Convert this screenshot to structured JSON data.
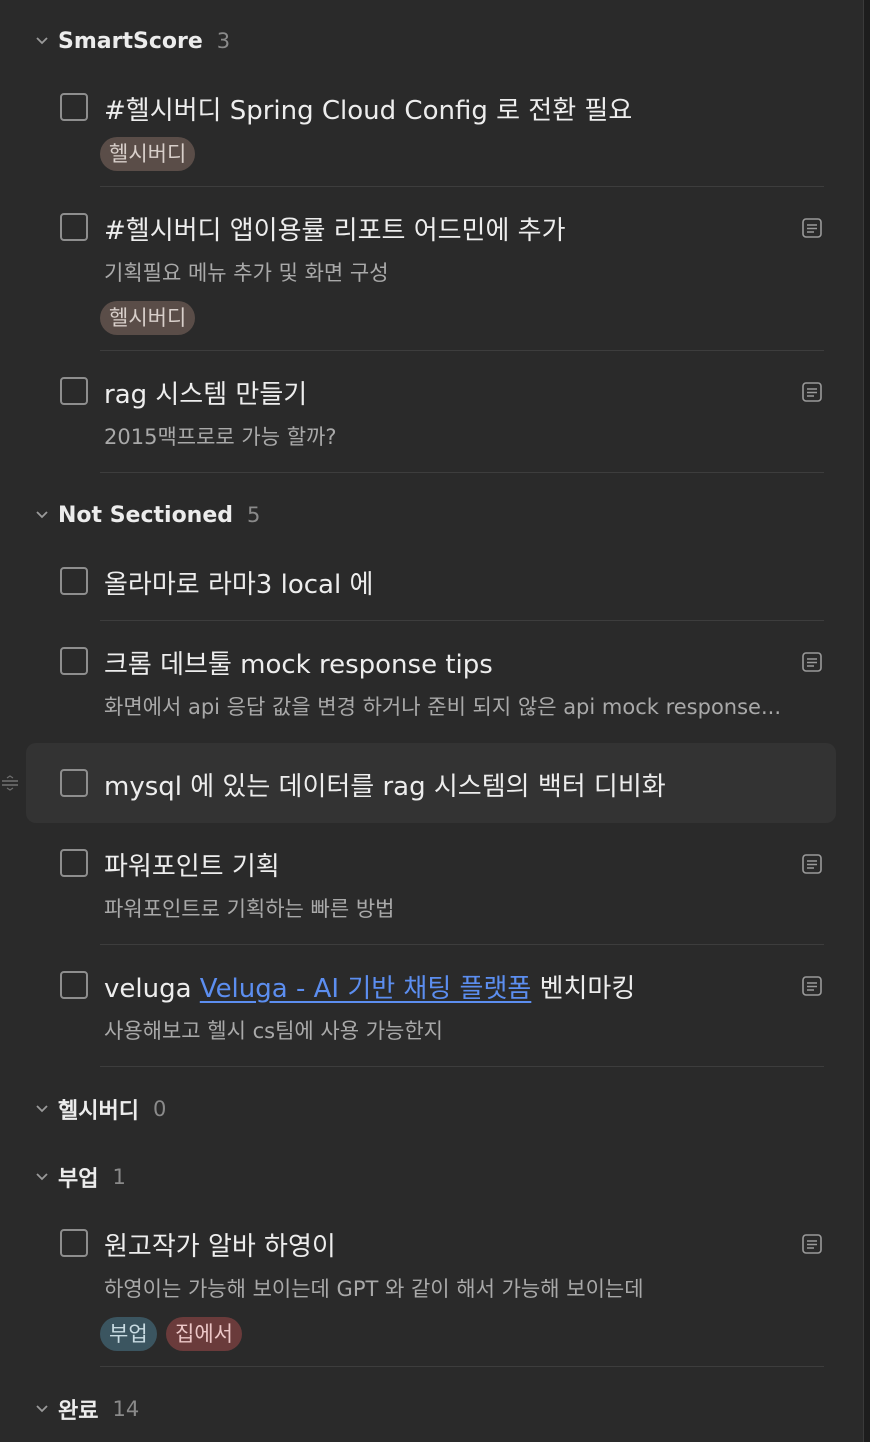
{
  "colors": {
    "background": "#2a2a2a",
    "tag_healthbuddy": "#5a4d48",
    "tag_sidejob": "#3b5560",
    "tag_home": "#6a3b3b",
    "link": "#5c8ef0"
  },
  "sections": [
    {
      "title": "SmartScore",
      "count": "3",
      "tasks": [
        {
          "title": "#헬시버디 Spring Cloud Config 로 전환 필요",
          "tags": [
            "헬시버디"
          ]
        },
        {
          "title": "#헬시버디 앱이용률 리포트 어드민에 추가",
          "desc": "기획필요 메뉴 추가 및 화면 구성",
          "tags": [
            "헬시버디"
          ],
          "icon": "note-icon"
        },
        {
          "title": "rag 시스템 만들기",
          "desc": "2015맥프로로 가능 할까?",
          "icon": "note-icon"
        }
      ]
    },
    {
      "title": "Not Sectioned",
      "count": "5",
      "tasks": [
        {
          "title": "올라마로 라마3 local 에"
        },
        {
          "title": "크롬 데브툴 mock response tips",
          "desc": "화면에서 api 응답 값을 변경 하거나 준비 되지 않은 api mock response...",
          "icon": "note-icon"
        },
        {
          "title": "mysql 에 있는 데이터를 rag 시스템의 백터 디비화"
        },
        {
          "title": "파워포인트 기획",
          "desc": "파워포인트로 기획하는 빠른 방법",
          "icon": "note-icon"
        },
        {
          "title_prefix": "veluga ",
          "title_link": "Veluga - AI 기반 채팅 플랫폼",
          "title_suffix": " 벤치마킹",
          "desc": "사용해보고 헬시 cs팀에 사용 가능한지",
          "icon": "note-icon"
        }
      ]
    },
    {
      "title": "헬시버디",
      "count": "0",
      "tasks": []
    },
    {
      "title": "부업",
      "count": "1",
      "tasks": [
        {
          "title": "원고작가 알바 하영이",
          "desc": "하영이는 가능해 보이는데 GPT 와 같이 해서 가능해 보이는데",
          "tags": [
            "부업",
            "집에서"
          ],
          "icon": "note-icon"
        }
      ]
    },
    {
      "title": "완료",
      "count": "14",
      "tasks": []
    }
  ]
}
